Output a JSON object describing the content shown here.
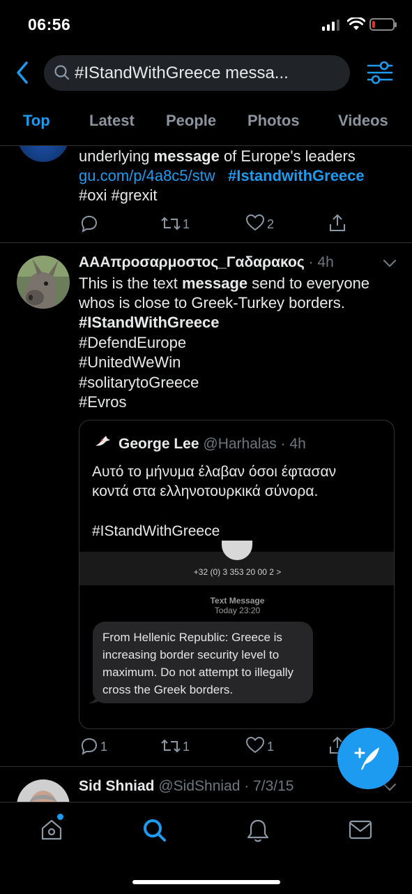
{
  "status_bar": {
    "time": "06:56",
    "battery_level": 0.15,
    "battery_color": "#e0302a"
  },
  "search": {
    "query": "#IStandWithGreece messa..."
  },
  "tabs": [
    {
      "label": "Top",
      "active": true
    },
    {
      "label": "Latest",
      "active": false
    },
    {
      "label": "People",
      "active": false
    },
    {
      "label": "Photos",
      "active": false
    },
    {
      "label": "Videos",
      "active": false
    }
  ],
  "tweet1": {
    "text_pre": "underlying ",
    "text_bold": "message",
    "text_post": " of Europe's leaders",
    "link": "gu.com/p/4a8c5/stw",
    "hashtag_bold": "#IstandwithGreece",
    "hashtags": "#oxi #grexit",
    "retweets": "1",
    "likes": "2"
  },
  "tweet2": {
    "name": "ΑΑΑπροσαρμοστος_Γαδαρακος",
    "time": "· 4h",
    "text_pre": "This is the text ",
    "text_bold": "message",
    "text_post": " send to everyone",
    "text_line2": "whos is close to Greek-Turkey borders.",
    "hashtag_bold": "#IStandWithGreece",
    "hashtags": [
      "#DefendEurope",
      "#UnitedWeWin",
      "#solitarytoGreece",
      "#Evros"
    ],
    "quote": {
      "name": "George Lee",
      "handle": "@Harhalas",
      "time": "· 4h",
      "text_line1": "Αυτό το μήνυμα έλαβαν όσοι έφτασαν",
      "text_line2": "κοντά στα ελληνοτουρκικά σύνορα.",
      "hashtag": "#IStandWithGreece",
      "sms": {
        "number": "+32 (0) 3 353 20 00 2 >",
        "label": "Text Message",
        "date": "Today 23:20",
        "message": "From Hellenic Republic: Greece is increasing border security level to maximum. Do not attempt to illegally cross the Greek borders."
      }
    },
    "replies": "1",
    "retweets": "1",
    "likes": "1"
  },
  "tweet3": {
    "name": "Sid Shniad",
    "handle": "@SidShniad",
    "time": "· 7/3/15"
  },
  "colors": {
    "accent": "#1d9bf0",
    "background": "#000000",
    "divider": "#2f3336"
  }
}
